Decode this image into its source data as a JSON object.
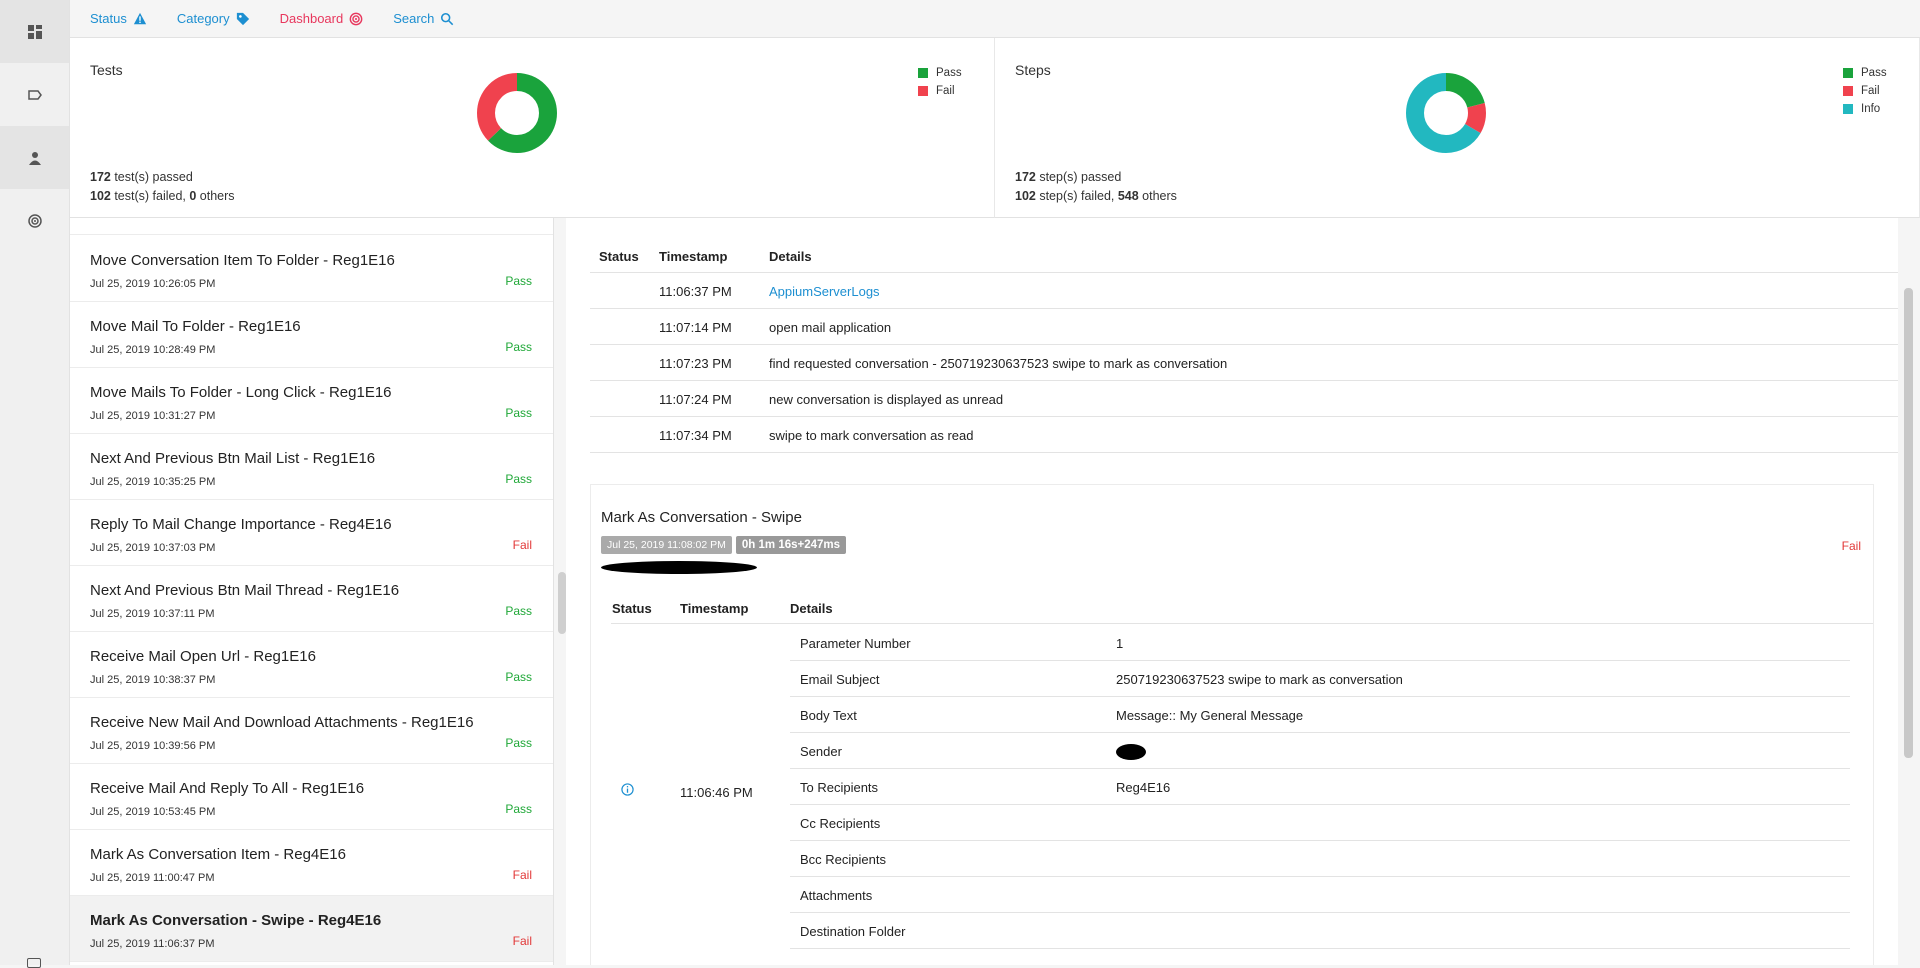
{
  "nav": {
    "status": "Status",
    "category": "Category",
    "dashboard": "Dashboard",
    "search": "Search"
  },
  "colors": {
    "pass": "#1aa33c",
    "fail": "#f0424e",
    "info": "#22b8c0",
    "link": "#1d8fd1"
  },
  "tests_card": {
    "title": "Tests",
    "legend": [
      "Pass",
      "Fail"
    ],
    "passed_count": "172",
    "passed_text": " test(s) passed",
    "failed_count": "102",
    "failed_text": " test(s) failed, ",
    "others_count": "0",
    "others_text": " others"
  },
  "steps_card": {
    "title": "Steps",
    "legend": [
      "Pass",
      "Fail",
      "Info"
    ],
    "passed_count": "172",
    "passed_text": " step(s) passed",
    "failed_count": "102",
    "failed_text": " step(s) failed, ",
    "others_count": "548",
    "others_text": " others"
  },
  "chart_data": [
    {
      "type": "pie",
      "title": "Tests",
      "categories": [
        "Pass",
        "Fail"
      ],
      "values": [
        172,
        102
      ]
    },
    {
      "type": "pie",
      "title": "Steps",
      "categories": [
        "Pass",
        "Fail",
        "Info"
      ],
      "values": [
        172,
        102,
        548
      ]
    }
  ],
  "tests": [
    {
      "name": "Move Conversation Item To Folder - Reg1E16",
      "time": "Jul 25, 2019 10:26:05 PM",
      "status": "Pass"
    },
    {
      "name": "Move Mail To Folder - Reg1E16",
      "time": "Jul 25, 2019 10:28:49 PM",
      "status": "Pass"
    },
    {
      "name": "Move Mails To Folder - Long Click - Reg1E16",
      "time": "Jul 25, 2019 10:31:27 PM",
      "status": "Pass"
    },
    {
      "name": "Next And Previous Btn Mail List - Reg1E16",
      "time": "Jul 25, 2019 10:35:25 PM",
      "status": "Pass"
    },
    {
      "name": "Reply To Mail Change Importance - Reg4E16",
      "time": "Jul 25, 2019 10:37:03 PM",
      "status": "Fail"
    },
    {
      "name": "Next And Previous Btn Mail Thread - Reg1E16",
      "time": "Jul 25, 2019 10:37:11 PM",
      "status": "Pass"
    },
    {
      "name": "Receive Mail Open Url - Reg1E16",
      "time": "Jul 25, 2019 10:38:37 PM",
      "status": "Pass"
    },
    {
      "name": "Receive New Mail And Download Attachments - Reg1E16",
      "time": "Jul 25, 2019 10:39:56 PM",
      "status": "Pass"
    },
    {
      "name": "Receive Mail And Reply To All - Reg1E16",
      "time": "Jul 25, 2019 10:53:45 PM",
      "status": "Pass"
    },
    {
      "name": "Mark As Conversation Item - Reg4E16",
      "time": "Jul 25, 2019 11:00:47 PM",
      "status": "Fail"
    },
    {
      "name": "Mark As Conversation - Swipe - Reg4E16",
      "time": "Jul 25, 2019 11:06:37 PM",
      "status": "Fail"
    }
  ],
  "steps_table": {
    "headers": [
      "Status",
      "Timestamp",
      "Details"
    ],
    "rows": [
      {
        "status": "info",
        "time": "11:06:37 PM",
        "details": "AppiumServerLogs",
        "link": true
      },
      {
        "status": "pass",
        "time": "11:07:14 PM",
        "details": "open mail application"
      },
      {
        "status": "pass",
        "time": "11:07:23 PM",
        "details": "find requested conversation - 250719230637523 swipe to mark as conversation"
      },
      {
        "status": "pass",
        "time": "11:07:24 PM",
        "details": "new conversation is displayed as unread"
      },
      {
        "status": "fail",
        "time": "11:07:34 PM",
        "details": "swipe to mark conversation as read"
      }
    ]
  },
  "test_detail": {
    "title": "Mark As Conversation - Swipe",
    "started": "Jul 25, 2019 11:08:02 PM",
    "duration": "0h 1m 16s+247ms",
    "status": "Fail",
    "headers": [
      "Status",
      "Timestamp",
      "Details"
    ],
    "timestamp": "11:06:46 PM",
    "params": [
      {
        "key": "Parameter Number",
        "value": "1"
      },
      {
        "key": "Email Subject",
        "value": "250719230637523 swipe to mark as conversation"
      },
      {
        "key": "Body Text",
        "value": "Message:: My General Message"
      },
      {
        "key": "Sender",
        "value": ""
      },
      {
        "key": "To Recipients",
        "value": "Reg4E16"
      },
      {
        "key": "Cc Recipients",
        "value": ""
      },
      {
        "key": "Bcc Recipients",
        "value": ""
      },
      {
        "key": "Attachments",
        "value": ""
      },
      {
        "key": "Destination Folder",
        "value": ""
      }
    ]
  }
}
